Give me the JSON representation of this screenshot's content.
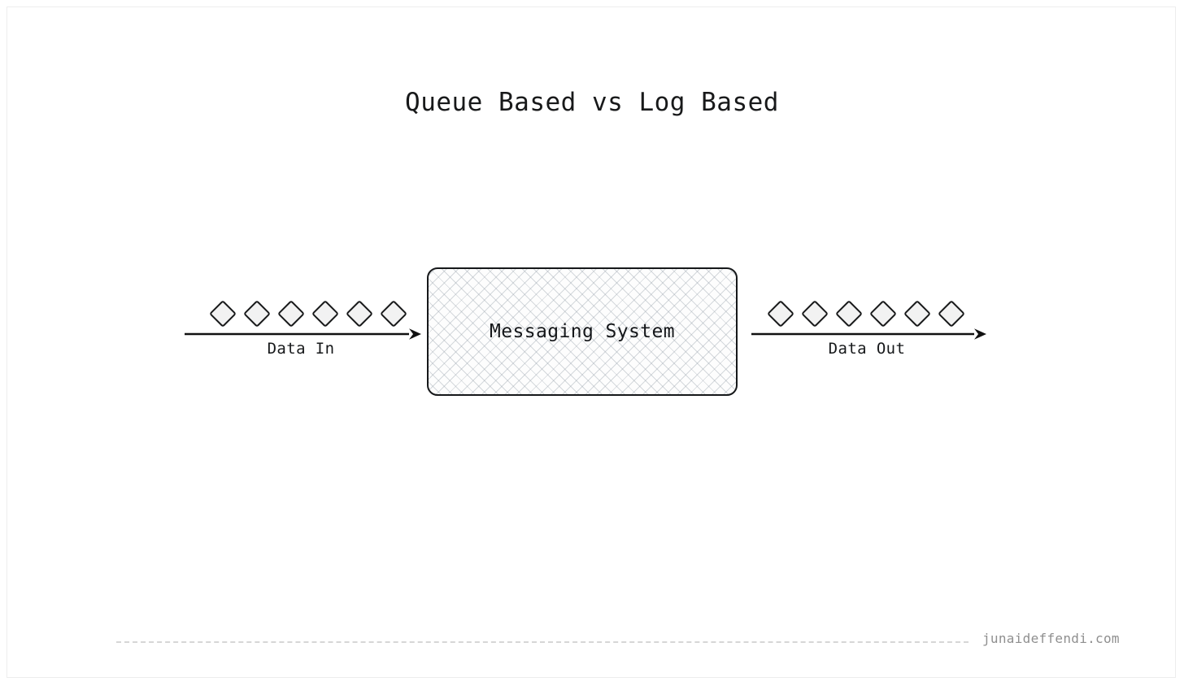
{
  "diagram": {
    "title": "Queue Based vs Log Based",
    "background_color": "#ffffff",
    "border_color": "#ededed",
    "node": {
      "label": "Messaging System",
      "fill": "#fdfdfd",
      "stroke": "#16181a",
      "hatch_color": "#96a0aa"
    },
    "flows": [
      {
        "id": "data-in",
        "label": "Data In",
        "direction": "right",
        "icon": "diamond-icon",
        "item_count": 6,
        "item_fill": "#f2f2f2",
        "item_stroke": "#18191a",
        "arrow_color": "#111111"
      },
      {
        "id": "data-out",
        "label": "Data Out",
        "direction": "right",
        "icon": "diamond-icon",
        "item_count": 6,
        "item_fill": "#f2f2f2",
        "item_stroke": "#18191a",
        "arrow_color": "#111111"
      }
    ]
  },
  "footer": {
    "watermark": "junaideffendi.com",
    "watermark_color": "#8f8f8f",
    "divider_color": "#d6d6d6"
  }
}
